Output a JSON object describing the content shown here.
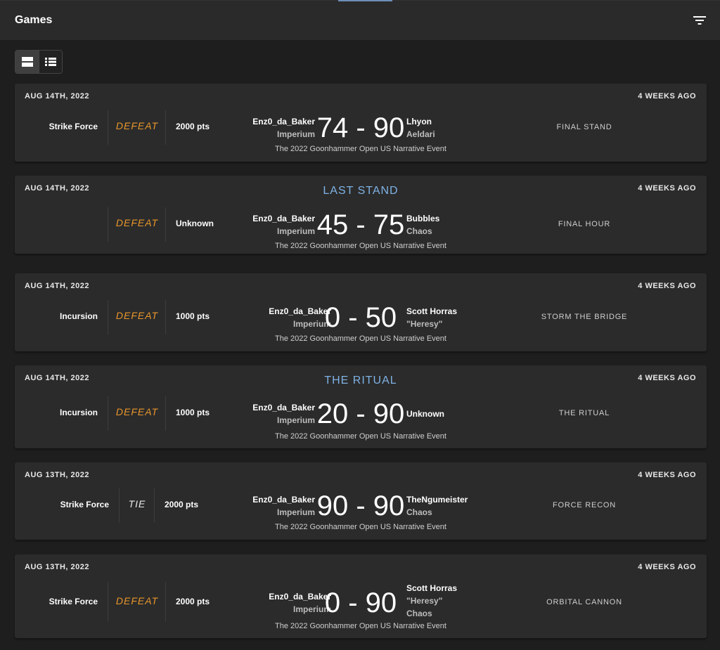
{
  "header": {
    "title": "Games"
  },
  "view_toggle": {
    "card_label": "Card view",
    "list_label": "List view"
  },
  "games": [
    {
      "date": "AUG 14TH, 2022",
      "ago": "4 WEEKS AGO",
      "title": "",
      "mode": "Strike Force",
      "result": "DEFEAT",
      "points": "2000 pts",
      "player1": "Enz0_da_Baker",
      "faction1": "Imperium",
      "score": "74 - 90",
      "player2": "Lhyon",
      "faction2": "Aeldari",
      "faction2b": "",
      "mission": "FINAL STAND",
      "event": "The 2022 Goonhammer Open US Narrative Event"
    },
    {
      "date": "AUG 14TH, 2022",
      "ago": "4 WEEKS AGO",
      "title": "LAST STAND",
      "mode": "",
      "result": "DEFEAT",
      "points": "Unknown",
      "player1": "Enz0_da_Baker",
      "faction1": "Imperium",
      "score": "45 - 75",
      "player2": "Bubbles",
      "faction2": "Chaos",
      "faction2b": "",
      "mission": "FINAL HOUR",
      "event": "The 2022 Goonhammer Open US Narrative Event"
    },
    {
      "date": "AUG 14TH, 2022",
      "ago": "4 WEEKS AGO",
      "title": "",
      "mode": "Incursion",
      "result": "DEFEAT",
      "points": "1000 pts",
      "player1": "Enz0_da_Baker",
      "faction1": "Imperium",
      "score": "0 - 50",
      "player2": "Scott Horras",
      "faction2": "\"Heresy\"",
      "faction2b": "",
      "mission": "STORM THE BRIDGE",
      "event": "The 2022 Goonhammer Open US Narrative Event"
    },
    {
      "date": "AUG 14TH, 2022",
      "ago": "4 WEEKS AGO",
      "title": "THE RITUAL",
      "mode": "Incursion",
      "result": "DEFEAT",
      "points": "1000 pts",
      "player1": "Enz0_da_Baker",
      "faction1": "Imperium",
      "score": "20 - 90",
      "player2": "Unknown",
      "faction2": "",
      "faction2b": "",
      "mission": "THE RITUAL",
      "event": "The 2022 Goonhammer Open US Narrative Event"
    },
    {
      "date": "AUG 13TH, 2022",
      "ago": "4 WEEKS AGO",
      "title": "",
      "mode": "Strike Force",
      "result": "TIE",
      "points": "2000 pts",
      "player1": "Enz0_da_Baker",
      "faction1": "Imperium",
      "score": "90 - 90",
      "player2": "TheNgumeister",
      "faction2": "Chaos",
      "faction2b": "",
      "mission": "FORCE RECON",
      "event": "The 2022 Goonhammer Open US Narrative Event"
    },
    {
      "date": "AUG 13TH, 2022",
      "ago": "4 WEEKS AGO",
      "title": "",
      "mode": "Strike Force",
      "result": "DEFEAT",
      "points": "2000 pts",
      "player1": "Enz0_da_Baker",
      "faction1": "Imperium",
      "score": "0 - 90",
      "player2": "Scott Horras",
      "faction2": "\"Heresy\"",
      "faction2b": "Chaos",
      "mission": "ORBITAL CANNON",
      "event": "The 2022 Goonhammer Open US Narrative Event"
    }
  ],
  "colors": {
    "defeat": "#e8962b",
    "title": "#7fb2e5",
    "card": "#2b2b2b"
  }
}
